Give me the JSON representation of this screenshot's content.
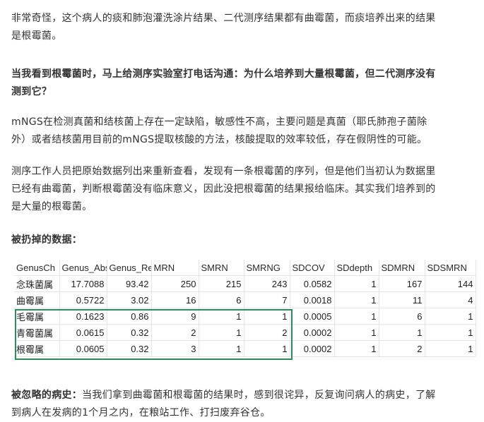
{
  "paragraphs": {
    "p1_line1": "非常奇怪，这个病人的痰和肺泡灌洗涂片结果、二代测序结果都有曲霉菌，而痰培养出来的结果",
    "p1_line2": "是根霉菌。",
    "p2_line1": "当我看到根霉菌时，马上给测序实验室打电话沟通：为什么培养到大量根霉菌，但二代测序没有",
    "p2_line2": "测到它？",
    "p3_line1": "mNGS在检测真菌和结核菌上存在一定缺陷，敏感性不高，主要问题是真菌（耶氏肺孢子菌除",
    "p3_line2": "外）或者结核菌用目前的mNGS提取核酸的方法，核酸提取的效率较低，存在假阴性的可能。",
    "p4_line1": "测序工作人员把原始数据列出来重新查看，发现有一条根霉菌的序列，但是他们当初认为数据里",
    "p4_line2": "已经有曲霉菌，判断根霉菌没有临床意义，因此没把根霉菌的结果报给临床。其实我们培养到的",
    "p4_line3": "是大量的根霉菌。",
    "table_label": "被扔掉的数据：",
    "p6_bold": "被忽略的病史：",
    "p6_line1_rest": "当我们拿到曲霉菌和根霉菌的结果时，感到很诧异，反复询问病人的病史，了解",
    "p6_line2": "到病人在发病的1个月之内，在粮站工作、打扫废弃谷仓。"
  },
  "table": {
    "headers": [
      "GenusCh",
      "Genus_Abs",
      "Genus_Re_",
      "MRN",
      "SMRN",
      "SMRNG",
      "SDCOV",
      "SDdepth",
      "SDMRN",
      "SDSMRN"
    ],
    "rows": [
      [
        "念珠菌属",
        "17.7088",
        "93.42",
        "250",
        "215",
        "243",
        "0.0582",
        "1",
        "167",
        "144"
      ],
      [
        "曲霉属",
        "0.5722",
        "3.02",
        "16",
        "6",
        "7",
        "0.0018",
        "1",
        "11",
        "4"
      ],
      [
        "毛霉属",
        "0.1623",
        "0.86",
        "9",
        "1",
        "1",
        "0.0005",
        "1",
        "6",
        "1"
      ],
      [
        "青霉菌属",
        "0.0615",
        "0.32",
        "2",
        "1",
        "2",
        "0.0002",
        "1",
        "1",
        "1"
      ],
      [
        "根霉属",
        "0.0605",
        "0.32",
        "3",
        "1",
        "1",
        "0.0002",
        "1",
        "2",
        "1"
      ]
    ],
    "highlight_color": "#2f8a5a"
  }
}
